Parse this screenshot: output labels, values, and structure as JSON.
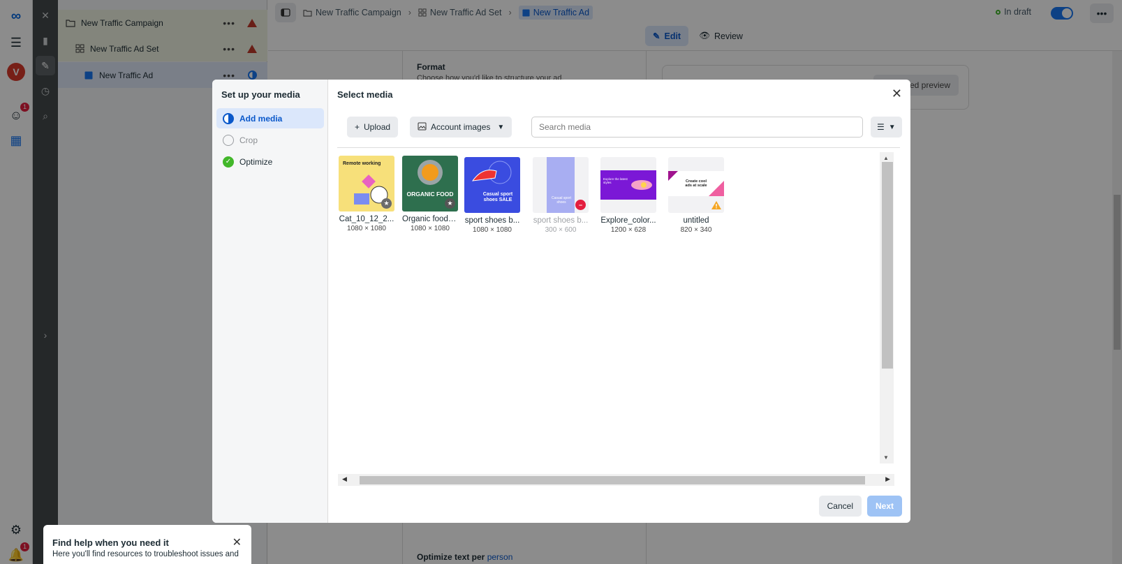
{
  "tree": {
    "campaign": "New Traffic Campaign",
    "adset": "New Traffic Ad Set",
    "ad": "New Traffic Ad"
  },
  "rail": {
    "avatar_letter": "V",
    "notif_count": "1",
    "bell_count": "1"
  },
  "topbar": {
    "crumbs": [
      "New Traffic Campaign",
      "New Traffic Ad Set",
      "New Traffic Ad"
    ],
    "status": "In draft",
    "edit_label": "Edit",
    "review_label": "Review"
  },
  "editor": {
    "format_title": "Format",
    "format_sub": "Choose how you'd like to structure your ad.",
    "optimize_text": "Optimize text per",
    "optimize_link": "person",
    "preview_button": "Advanced preview"
  },
  "help": {
    "title": "Find help when you need it",
    "body": "Here you'll find resources to troubleshoot issues and"
  },
  "modal": {
    "left_title": "Set up your media",
    "steps": [
      "Add media",
      "Crop",
      "Optimize"
    ],
    "right_title": "Select media",
    "upload_label": "Upload",
    "source_label": "Account images",
    "search_placeholder": "Search media",
    "cancel_label": "Cancel",
    "next_label": "Next",
    "media": [
      {
        "name": "Cat_10_12_2...",
        "dims": "1080 × 1080",
        "thumb_text": "Remote working"
      },
      {
        "name": "Organic food_...",
        "dims": "1080 × 1080",
        "thumb_text": "ORGANIC FOOD"
      },
      {
        "name": "sport shoes b...",
        "dims": "1080 × 1080",
        "thumb_text": "Casual sport shoes SALE"
      },
      {
        "name": "sport shoes b...",
        "dims": "300 × 600",
        "thumb_text": "Casual sport shoes"
      },
      {
        "name": "Explore_color...",
        "dims": "1200 × 628",
        "thumb_text": "Explore the latest styles"
      },
      {
        "name": "untitled",
        "dims": "820 × 340",
        "thumb_text": "Create cool ads at scale"
      }
    ]
  },
  "colors": {
    "accent": "#1877f2",
    "warning": "#c0392b",
    "success": "#42b72a"
  }
}
